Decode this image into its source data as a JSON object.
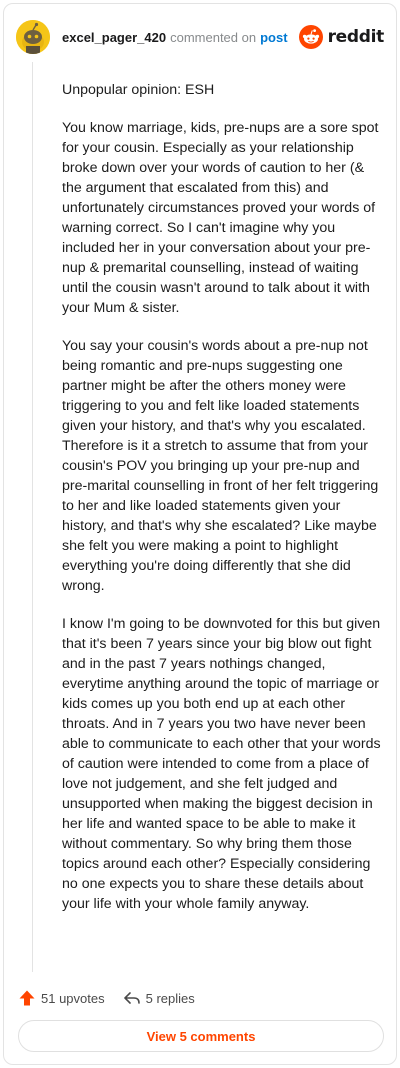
{
  "header": {
    "username": "excel_pager_420",
    "action_text": "commented on",
    "post_link": "post",
    "logo_text": "reddit"
  },
  "comment": {
    "paragraphs": [
      "Unpopular opinion: ESH",
      "You know marriage, kids, pre-nups are a sore spot for your cousin. Especially as your relationship broke down over your words of caution to her (& the argument that escalated from this) and unfortunately circumstances proved your words of warning correct. So I can't imagine why you included her in your conversation about your pre-nup & premarital counselling, instead of waiting until the cousin wasn't around to talk about it with your Mum & sister.",
      "You say your cousin's words about a pre-nup not being romantic and pre-nups suggesting one partner might be after the others money were triggering to you and felt like loaded statements given your history, and that's why you escalated. Therefore is it a stretch to assume that from your cousin's POV you bringing up your pre-nup and pre-marital counselling in front of her felt triggering to her and like loaded statements given your history, and that's why she escalated? Like maybe she felt you were making a point to highlight everything you're doing differently that she did wrong.",
      "I know I'm going to be downvoted for this but given that it's been 7 years since your big blow out fight and in the past 7 years nothings changed, everytime anything around the topic of marriage or kids comes up you both end up at each other throats. And in 7 years you two have never been able to communicate to each other that your words of caution were intended to come from a place of love not judgement, and she felt judged and unsupported when making the biggest decision in her life and wanted space to be able to make it without commentary. So why bring them those topics around each other? Especially considering no one expects you to share these details about your life with your whole family anyway."
    ]
  },
  "footer": {
    "upvotes": "51 upvotes",
    "replies": "5 replies",
    "view_comments": "View 5 comments"
  },
  "icons": {
    "upvote": "upvote-arrow-icon",
    "reply": "reply-arrow-icon",
    "avatar": "snoo-avatar-icon",
    "logo": "reddit-snoo-logo-icon"
  },
  "colors": {
    "accent": "#ff4500",
    "link": "#0079d3",
    "avatar_bg": "#f5c518"
  }
}
